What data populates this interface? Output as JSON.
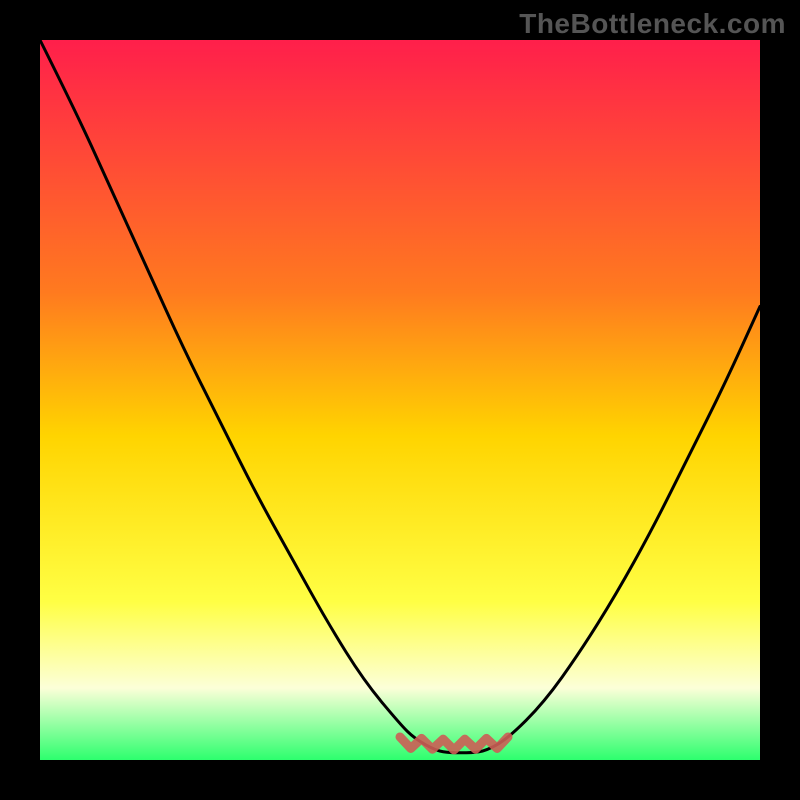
{
  "watermark": "TheBottleneck.com",
  "colors": {
    "background": "#000000",
    "grad_top": "#ff1f4b",
    "grad_mid_upper": "#ff7a1f",
    "grad_mid": "#ffd400",
    "grad_mid_lower": "#ffff44",
    "grad_pale": "#fcffd8",
    "grad_green": "#2dff6e",
    "curve_stroke": "#000000",
    "rough_stroke": "#cc5e55"
  },
  "chart_data": {
    "type": "line",
    "title": "",
    "xlabel": "",
    "ylabel": "",
    "xlim": [
      0,
      100
    ],
    "ylim": [
      0,
      100
    ],
    "series": [
      {
        "name": "bottleneck-curve",
        "x": [
          0,
          5,
          10,
          15,
          20,
          25,
          30,
          35,
          40,
          45,
          50,
          52,
          55,
          57,
          60,
          62,
          65,
          70,
          75,
          80,
          85,
          90,
          95,
          100
        ],
        "y": [
          100,
          90,
          79,
          68,
          57,
          47,
          37,
          28,
          19,
          11,
          5,
          3,
          1.3,
          1.0,
          1.0,
          1.3,
          3,
          8,
          15,
          23,
          32,
          42,
          52,
          63
        ]
      },
      {
        "name": "rough-bottom-segment",
        "x": [
          50,
          51.5,
          53,
          54.5,
          56,
          57.5,
          59,
          60.5,
          62,
          63.5,
          65
        ],
        "y": [
          3.2,
          1.6,
          3.0,
          1.5,
          2.9,
          1.4,
          2.9,
          1.5,
          3.0,
          1.6,
          3.2
        ]
      }
    ]
  }
}
